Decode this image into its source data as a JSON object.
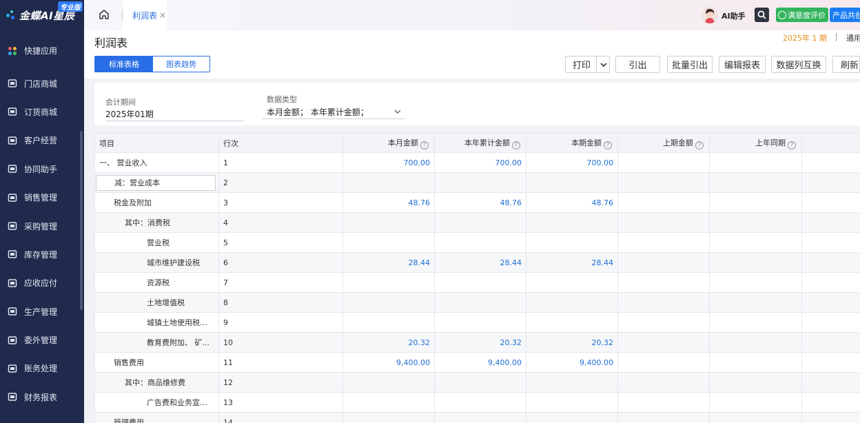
{
  "app": {
    "logo_text": "金蝶AI星辰",
    "edition_badge": "专业版"
  },
  "sidebar": {
    "items": [
      {
        "label": "快捷应用",
        "icon": "apps-grid-icon"
      },
      {
        "label": "门店商城",
        "icon": "store-icon"
      },
      {
        "label": "订货商城",
        "icon": "shopping-bag-icon"
      },
      {
        "label": "客户经营",
        "icon": "customer-icon"
      },
      {
        "label": "协同助手",
        "icon": "collab-icon"
      },
      {
        "label": "销售管理",
        "icon": "sales-chart-icon"
      },
      {
        "label": "采购管理",
        "icon": "cart-icon"
      },
      {
        "label": "库存管理",
        "icon": "box-icon"
      },
      {
        "label": "应收应付",
        "icon": "finance-icon"
      },
      {
        "label": "生产管理",
        "icon": "factory-icon"
      },
      {
        "label": "委外管理",
        "icon": "outsource-icon"
      },
      {
        "label": "账务处理",
        "icon": "ledger-icon"
      },
      {
        "label": "财务报表",
        "icon": "report-icon"
      }
    ]
  },
  "topbar": {
    "tab_label": "利润表",
    "ai_label": "AI助手",
    "rate_label": "满意度评价",
    "product_label": "产品共创"
  },
  "page": {
    "title": "利润表",
    "period": "2025年 1 期",
    "general": "通用",
    "view_table": "标准表格",
    "view_chart": "图表趋势",
    "buttons": {
      "print": "打印",
      "export": "引出",
      "batch_export": "批量引出",
      "edit_report": "编辑报表",
      "swap_columns": "数据列互换",
      "refresh": "刷新"
    }
  },
  "filter": {
    "period_label": "会计期间",
    "period_value": "2025年01期",
    "type_label": "数据类型",
    "type_value": "本月金额；  本年累计金额；"
  },
  "table": {
    "headers": {
      "item": "项目",
      "row": "行次",
      "month": "本月金额",
      "ytd": "本年累计金额",
      "current": "本期金额",
      "prev": "上期金额",
      "last_year": "上年同期"
    },
    "rows": [
      {
        "item": "一、 营业收入",
        "row": "1",
        "month": "700.00",
        "ytd": "700.00",
        "current": "700.00",
        "prev": "",
        "last_year": "",
        "indent": 0
      },
      {
        "item": "减：营业成本",
        "row": "2",
        "month": "",
        "ytd": "",
        "current": "",
        "prev": "",
        "last_year": "",
        "indent": 0
      },
      {
        "item": "税金及附加",
        "row": "3",
        "month": "48.76",
        "ytd": "48.76",
        "current": "48.76",
        "prev": "",
        "last_year": "",
        "indent": 1
      },
      {
        "item": "其中：消费税",
        "row": "4",
        "month": "",
        "ytd": "",
        "current": "",
        "prev": "",
        "last_year": "",
        "indent": 2
      },
      {
        "item": "营业税",
        "row": "5",
        "month": "",
        "ytd": "",
        "current": "",
        "prev": "",
        "last_year": "",
        "indent": 3
      },
      {
        "item": "城市维护建设税",
        "row": "6",
        "month": "28.44",
        "ytd": "28.44",
        "current": "28.44",
        "prev": "",
        "last_year": "",
        "indent": 3
      },
      {
        "item": "资源税",
        "row": "7",
        "month": "",
        "ytd": "",
        "current": "",
        "prev": "",
        "last_year": "",
        "indent": 3
      },
      {
        "item": "土地增值税",
        "row": "8",
        "month": "",
        "ytd": "",
        "current": "",
        "prev": "",
        "last_year": "",
        "indent": 3
      },
      {
        "item": "城镇土地使用税、...",
        "row": "9",
        "month": "",
        "ytd": "",
        "current": "",
        "prev": "",
        "last_year": "",
        "indent": 3
      },
      {
        "item": "教育费附加、 矿...",
        "row": "10",
        "month": "20.32",
        "ytd": "20.32",
        "current": "20.32",
        "prev": "",
        "last_year": "",
        "indent": 3
      },
      {
        "item": "销售费用",
        "row": "11",
        "month": "9,400.00",
        "ytd": "9,400.00",
        "current": "9,400.00",
        "prev": "",
        "last_year": "",
        "indent": 1
      },
      {
        "item": "其中：商品维修费",
        "row": "12",
        "month": "",
        "ytd": "",
        "current": "",
        "prev": "",
        "last_year": "",
        "indent": 2
      },
      {
        "item": "广告费和业务宣传...",
        "row": "13",
        "month": "",
        "ytd": "",
        "current": "",
        "prev": "",
        "last_year": "",
        "indent": 3
      },
      {
        "item": "管理费用",
        "row": "14",
        "month": "",
        "ytd": "",
        "current": "",
        "prev": "",
        "last_year": "",
        "indent": 1
      }
    ]
  },
  "colors": {
    "sidebar_bg": "#1f2a4d",
    "accent": "#2a6ee6",
    "amount_text": "#1f6fd6",
    "period_text": "#e58b16",
    "rate_green": "#33b45d"
  }
}
